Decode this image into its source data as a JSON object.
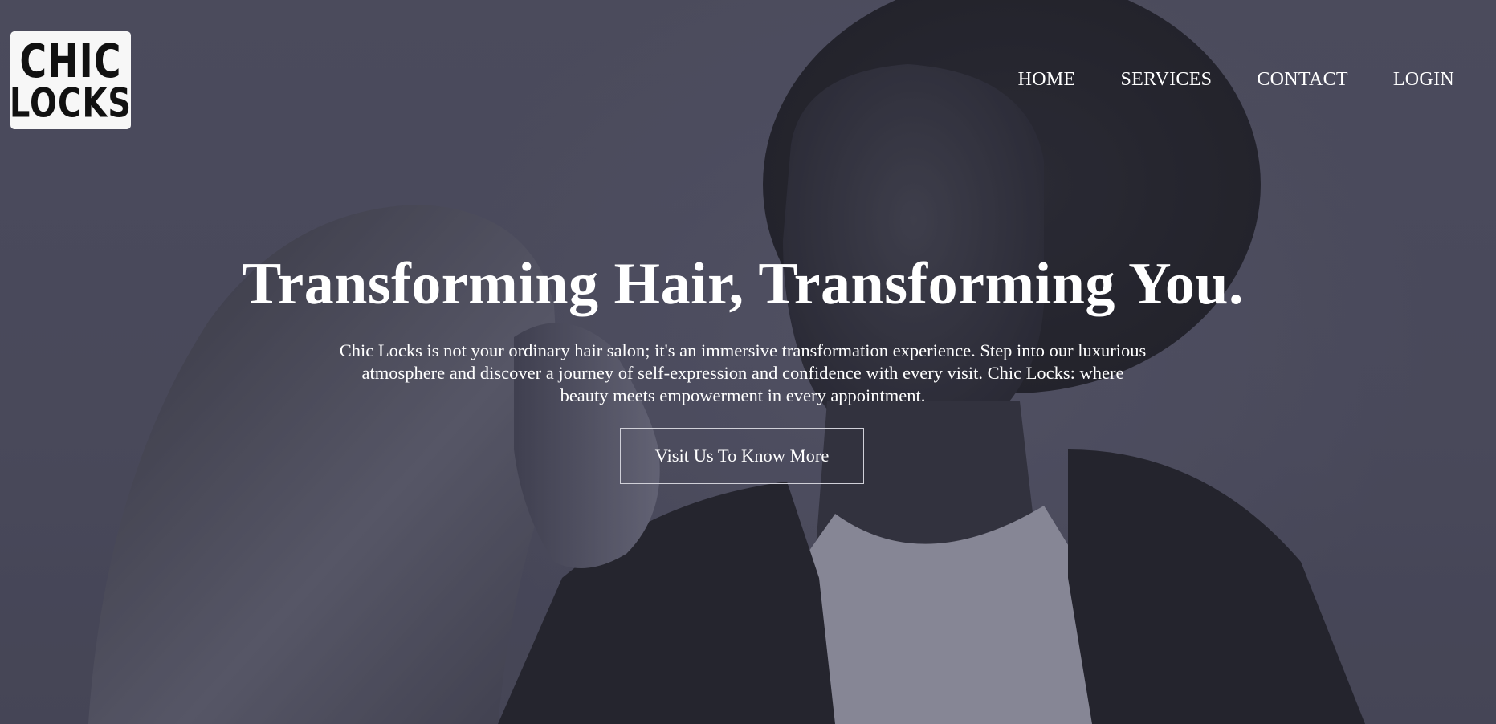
{
  "brand": {
    "logo_line_1": "CHIC",
    "logo_line_2": "LOCKS"
  },
  "nav": {
    "items": [
      {
        "label": "HOME"
      },
      {
        "label": "SERVICES"
      },
      {
        "label": "CONTACT"
      },
      {
        "label": "LOGIN"
      }
    ]
  },
  "hero": {
    "headline": "Transforming Hair, Transforming You.",
    "description": "Chic Locks is not your ordinary hair salon; it's an immersive transformation experience. Step into our luxurious atmosphere and discover a journey of self-expression and confidence with every visit. Chic Locks: where beauty meets empowerment in every appointment.",
    "cta_label": "Visit Us To Know More"
  },
  "colors": {
    "overlay": "#4a4a5c",
    "text": "#ffffff",
    "logo_bg": "#f7f7f7"
  }
}
